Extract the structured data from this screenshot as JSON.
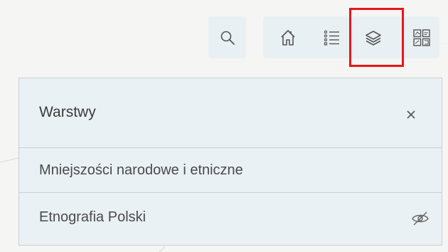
{
  "toolbar": {
    "search_icon": "search-icon",
    "home_icon": "home-icon",
    "legend_icon": "legend-list-icon",
    "layers_icon": "layers-icon",
    "basemap_icon": "basemap-gallery-icon",
    "highlight_color": "#e8161b"
  },
  "layer_panel": {
    "title": "Warstwy",
    "close_icon": "close-icon",
    "layers": [
      {
        "label": "Mniejszości narodowe i etniczne",
        "visible": true
      },
      {
        "label": "Etnografia Polski",
        "visible": false,
        "visibility_icon": "eye-off-icon"
      }
    ]
  },
  "colors": {
    "panel_bg": "#eaf1f5",
    "button_bg": "#e9f0f4",
    "text": "#3b3b3b"
  }
}
